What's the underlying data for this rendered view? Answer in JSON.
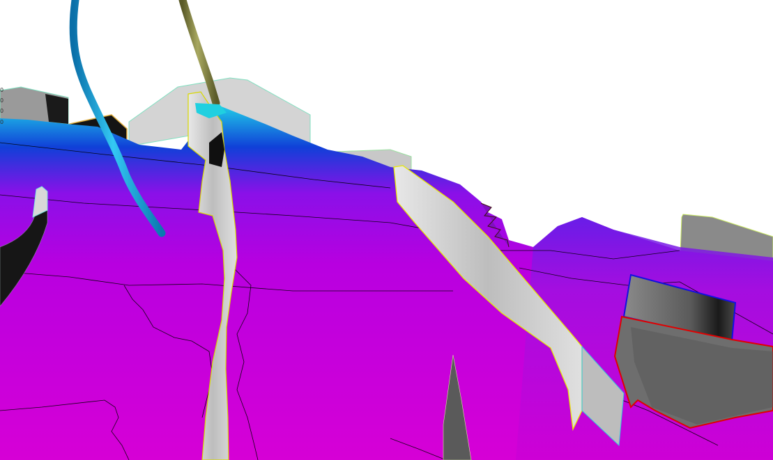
{
  "viewport": {
    "background": "#ffffff",
    "description_free": true
  },
  "axis_ticks": [
    "0",
    "0",
    "0",
    "0"
  ],
  "colors": {
    "surface_magenta": "#d400d8",
    "surface_purple": "#8a10e8",
    "surface_blue": "#2030d0",
    "surface_cyan": "#10c8e0",
    "fault_grey_light": "#d6d6d6",
    "fault_grey_dark": "#5a5a5a",
    "fault_black": "#141414",
    "well_cyan": "#1aa8e0",
    "well_olive": "#8a8a48",
    "edge_yellow": "#f0f000",
    "edge_red": "#e00000",
    "edge_blue": "#1010e0",
    "contour_black": "#000000"
  }
}
